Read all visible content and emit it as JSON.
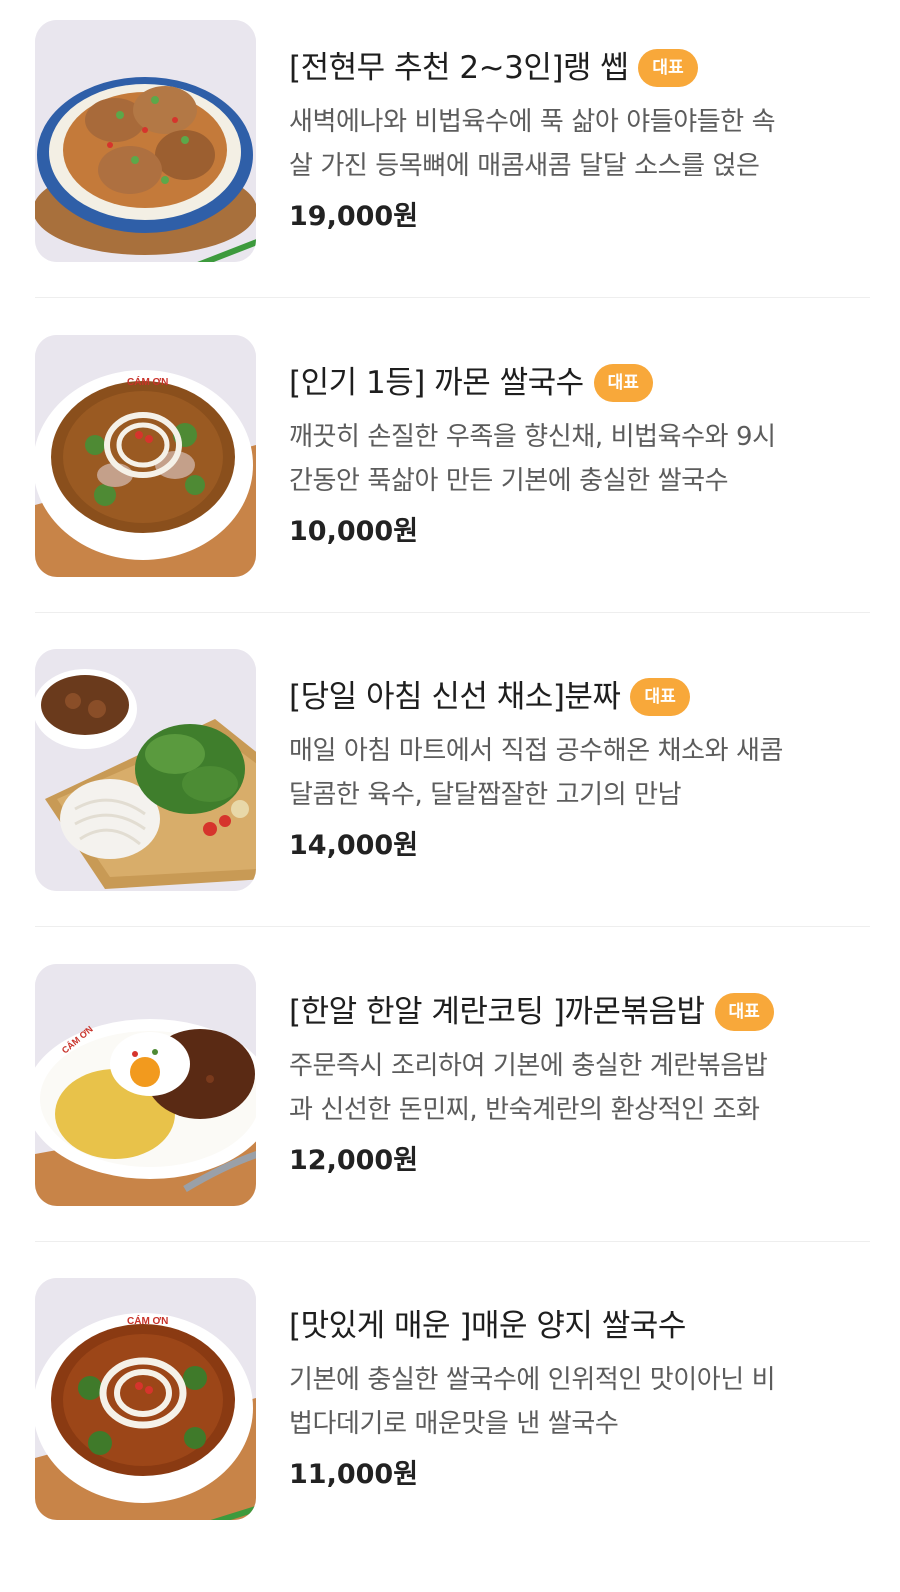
{
  "menu": {
    "items": [
      {
        "title": "[전현무 추천 2~3인]랭 쎕",
        "badge": "대표",
        "desc_line1": "새벽에나와 비법육수에 푹 삶아 야들야들한 속",
        "desc_line2": "살 가진 등목뼈에 매콤새콤 달달 소스를 얹은",
        "price": "19,000원",
        "image": "pork-back-bone-dish"
      },
      {
        "title": "[인기 1등] 까몬 쌀국수",
        "badge": "대표",
        "desc_line1": "깨끗히 손질한 우족을 향신채, 비법육수와 9시",
        "desc_line2": "간동안 푹삶아 만든 기본에 충실한 쌀국수",
        "price": "10,000원",
        "image": "beef-rice-noodle-soup"
      },
      {
        "title": "[당일 아침 신선 채소]분짜",
        "badge": "대표",
        "desc_line1": "매일 아침 마트에서 직접 공수해온 채소와 새콤",
        "desc_line2": "달콤한 육수, 달달짭잘한 고기의 만남",
        "price": "14,000원",
        "image": "bun-cha-platter"
      },
      {
        "title": "[한알 한알 계란코팅 ]까몬볶음밥",
        "badge": "대표",
        "desc_line1": "주문즉시 조리하여 기본에 충실한 계란볶음밥",
        "desc_line2": "과 신선한 돈민찌, 반숙계란의 환상적인 조화",
        "price": "12,000원",
        "image": "egg-fried-rice-plate"
      },
      {
        "title": "[맛있게 매운 ]매운 양지 쌀국수",
        "badge": "",
        "desc_line1": "기본에 충실한 쌀국수에 인위적인 맛이아닌 비",
        "desc_line2": "법다데기로 매운맛을 낸 쌀국수",
        "price": "11,000원",
        "image": "spicy-brisket-noodle-soup"
      }
    ]
  },
  "colors": {
    "badge": "#f8a83a",
    "title": "#1e1e1e",
    "desc": "#5c5c5c",
    "price": "#222222",
    "divider": "#eeeeee"
  }
}
